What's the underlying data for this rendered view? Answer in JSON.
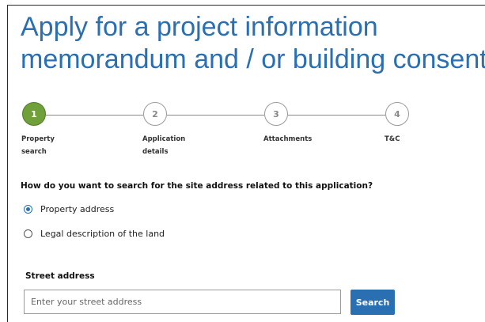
{
  "page": {
    "title_line1": "Apply for a project information",
    "title_line2": "memorandum and / or building consent"
  },
  "stepper": {
    "steps": [
      {
        "number": "1",
        "label_line1": "Property",
        "label_line2": "search",
        "state": "active"
      },
      {
        "number": "2",
        "label_line1": "Application",
        "label_line2": "details",
        "state": "upcoming"
      },
      {
        "number": "3",
        "label_line1": "Attachments",
        "label_line2": "",
        "state": "upcoming"
      },
      {
        "number": "4",
        "label_line1": "T&C",
        "label_line2": "",
        "state": "upcoming"
      }
    ]
  },
  "search_method": {
    "question": "How do you want to search for the site address related to this application?",
    "options": [
      {
        "label": "Property address",
        "checked": true
      },
      {
        "label": "Legal description of the land",
        "checked": false
      }
    ]
  },
  "street_address": {
    "label": "Street address",
    "placeholder": "Enter your street address",
    "value": "",
    "button_label": "Search"
  },
  "colors": {
    "brand_blue": "#2a6fb2",
    "active_step_green": "#6fa03a"
  }
}
